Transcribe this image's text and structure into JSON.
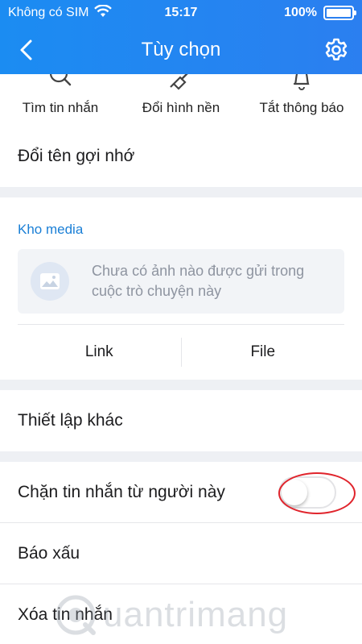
{
  "status_bar": {
    "carrier": "Không có SIM",
    "time": "15:17",
    "battery": "100%",
    "battery_level": 1.0
  },
  "header": {
    "title": "Tùy chọn",
    "back_icon": "chevron-left-icon",
    "settings_icon": "gear-icon"
  },
  "quick_actions": [
    {
      "label": "Tìm tin nhắn",
      "icon": "search-icon"
    },
    {
      "label": "Đổi hình nền",
      "icon": "paint-brush-icon"
    },
    {
      "label": "Tắt thông báo",
      "icon": "bell-icon"
    }
  ],
  "rename": {
    "label": "Đổi tên gợi nhớ"
  },
  "media": {
    "title": "Kho media",
    "empty_message": "Chưa có ảnh nào được gửi trong cuộc trò chuyện này",
    "tabs": [
      "Link",
      "File"
    ]
  },
  "other_settings": {
    "label": "Thiết lập khác"
  },
  "block": {
    "label": "Chặn tin nhắn từ người này",
    "enabled": false
  },
  "report": {
    "label": "Báo xấu"
  },
  "delete": {
    "label": "Xóa tin nhắn"
  },
  "watermark": {
    "text": "uantrimang"
  },
  "colors": {
    "header": "#1b8cf2",
    "accent": "#1a7fd6",
    "highlight": "#e0242c"
  }
}
